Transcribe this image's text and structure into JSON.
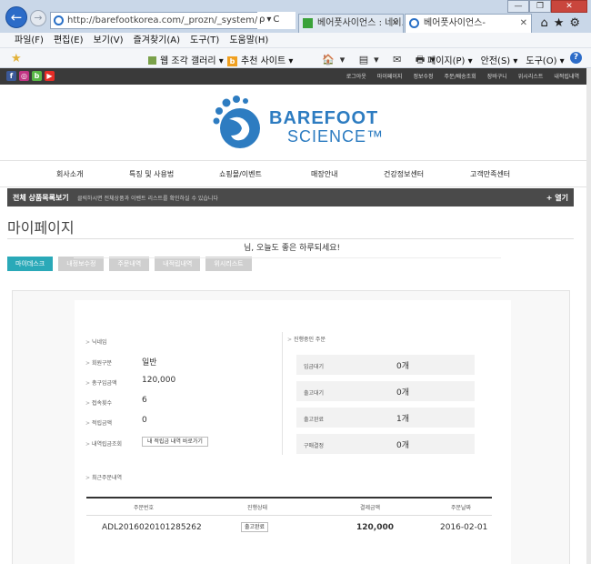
{
  "browser": {
    "url": "http://barefootkorea.com/_prozn/_system/member/r",
    "tabs": [
      {
        "title": "베어풋사이언스 : 네이...",
        "close": "✕"
      },
      {
        "title": "베어풋사이언스-",
        "close": "✕"
      }
    ],
    "window_buttons": {
      "minimize": "—",
      "maximize": "❐",
      "close": "✕"
    },
    "chrome_icons": "⌂★⚙",
    "addr_tools": "ρ▾C",
    "menu": [
      "파일(F)",
      "편집(E)",
      "보기(V)",
      "즐겨찾기(A)",
      "도구(T)",
      "도움말(H)"
    ],
    "favorites": {
      "gallery": "웹 조각 갤러리 ▾",
      "suggested": "추천 사이트 ▾",
      "suggested_icon": "b"
    },
    "command_icons": "🏠▾ ▤▾ ✉ 🖶▾",
    "command_menus": [
      "페이지(P) ▾",
      "안전(S) ▾",
      "도구(O) ▾"
    ],
    "help": "?"
  },
  "site": {
    "social": [
      "f",
      "◎",
      "b",
      "▶"
    ],
    "toplinks": [
      "로그아웃",
      "마이페이지",
      "정보수정",
      "주문/배송조회",
      "장바구니",
      "위시리스트",
      "내적립내역"
    ],
    "logo": {
      "line1": "BAREFOOT",
      "line2": "SCIENCE™"
    },
    "nav": [
      "회사소개",
      "특징 및 사용법",
      "쇼핑몰/이벤트",
      "매장안내",
      "건강정보센터",
      "고객만족센터"
    ],
    "catbar": {
      "title": "전체 상품목록보기",
      "desc": "클릭하시면 전체상품과 이벤트 리스트를 확인하실 수 있습니다",
      "open": "+ 열기"
    },
    "page_title": "마이페이지",
    "subtabs": [
      "마이데스크",
      "내정보수정",
      "주문내역",
      "내적립내역",
      "위시리스트"
    ],
    "greeting": "님, 오늘도 좋은 하루되세요!",
    "info": {
      "nickname_label": "닉네임",
      "member_type_label": "회원구분",
      "member_type": "일반",
      "total_purchase_label": "총구입금액",
      "total_purchase": "120,000",
      "visits_label": "접속횟수",
      "visits": "6",
      "points_label": "적립금액",
      "points": "0",
      "points_history_label": "내역립금조회",
      "points_history_button": "내 적립금 내역 바로가기"
    },
    "order_status": {
      "title": "진행중인 주문",
      "rows": [
        {
          "label": "입금대기",
          "count": "0개"
        },
        {
          "label": "출고대기",
          "count": "0개"
        },
        {
          "label": "출고완료",
          "count": "1개"
        },
        {
          "label": "구매결정",
          "count": "0개"
        }
      ]
    },
    "recent_orders": {
      "title": "최근주문내역",
      "headers": [
        "주문번호",
        "진행상태",
        "결제금액",
        "주문날짜"
      ],
      "rows": [
        {
          "order_no": "ADL2016020101285262",
          "status": "출고완료",
          "amount": "120,000",
          "date": "2016-02-01"
        }
      ]
    }
  }
}
